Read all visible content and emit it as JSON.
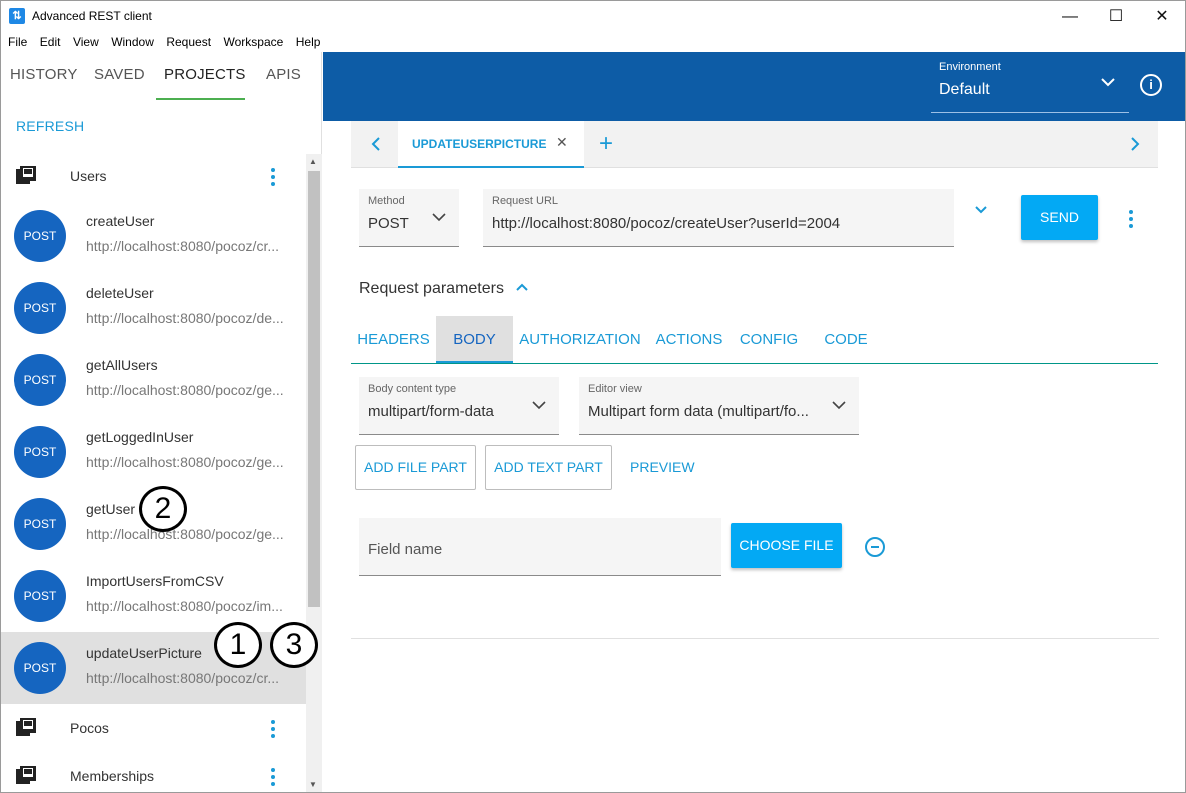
{
  "window": {
    "title": "Advanced REST client",
    "minimize": "—",
    "maximize": "☐",
    "close": "✕"
  },
  "menu": [
    "File",
    "Edit",
    "View",
    "Window",
    "Request",
    "Workspace",
    "Help"
  ],
  "sidebar": {
    "tabs": [
      "HISTORY",
      "SAVED",
      "PROJECTS",
      "APIS"
    ],
    "active_tab": "PROJECTS",
    "refresh_label": "REFRESH",
    "projects": [
      {
        "name": "Users"
      },
      {
        "name": "Pocos"
      },
      {
        "name": "Memberships"
      }
    ],
    "requests": [
      {
        "method": "POST",
        "name": "createUser",
        "url": "http://localhost:8080/pocoz/cr..."
      },
      {
        "method": "POST",
        "name": "deleteUser",
        "url": "http://localhost:8080/pocoz/de..."
      },
      {
        "method": "POST",
        "name": "getAllUsers",
        "url": "http://localhost:8080/pocoz/ge..."
      },
      {
        "method": "POST",
        "name": "getLoggedInUser",
        "url": "http://localhost:8080/pocoz/ge..."
      },
      {
        "method": "POST",
        "name": "getUser",
        "url": "http://localhost:8080/pocoz/ge..."
      },
      {
        "method": "POST",
        "name": "ImportUsersFromCSV",
        "url": "http://localhost:8080/pocoz/im..."
      },
      {
        "method": "POST",
        "name": "updateUserPicture",
        "url": "http://localhost:8080/pocoz/cr...",
        "selected": true
      }
    ]
  },
  "callouts": [
    "2",
    "1",
    "3"
  ],
  "environment": {
    "label": "Environment",
    "value": "Default"
  },
  "request_tab": {
    "label": "UPDATEUSERPICTURE",
    "close": "✕",
    "add": "+"
  },
  "request": {
    "method_label": "Method",
    "method_value": "POST",
    "url_label": "Request URL",
    "url_value": "http://localhost:8080/pocoz/createUser?userId=2004",
    "send_label": "SEND"
  },
  "params": {
    "label": "Request parameters"
  },
  "editor_tabs": [
    "HEADERS",
    "BODY",
    "AUTHORIZATION",
    "ACTIONS",
    "CONFIG",
    "CODE"
  ],
  "active_editor_tab": "BODY",
  "body": {
    "content_type_label": "Body content type",
    "content_type_value": "multipart/form-data",
    "editor_view_label": "Editor view",
    "editor_view_value": "Multipart form data (multipart/fo...",
    "add_file_part": "ADD FILE PART",
    "add_text_part": "ADD TEXT PART",
    "preview": "PREVIEW",
    "field_name_placeholder": "Field name",
    "choose_file": "CHOOSE FILE"
  },
  "colors": {
    "accent": "#1a9ad6",
    "topbar": "#0d5ca6",
    "badge": "#1565c0",
    "button": "#03a9f4"
  }
}
